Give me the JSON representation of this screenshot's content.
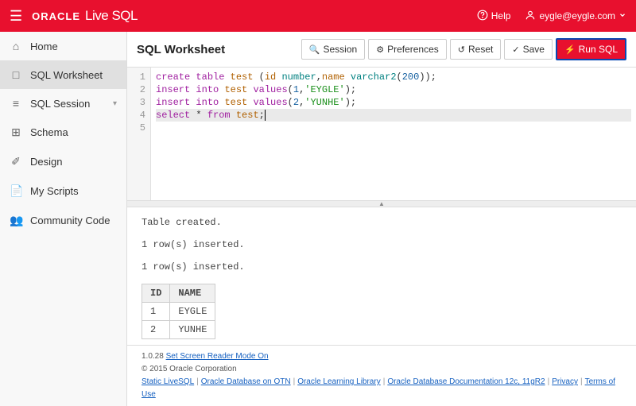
{
  "header": {
    "brand_prefix": "ORACLE",
    "brand_suffix": "Live SQL",
    "help_label": "Help",
    "user_label": "eygle@eygle.com"
  },
  "sidebar": {
    "items": [
      {
        "icon": "home",
        "label": "Home"
      },
      {
        "icon": "worksheet",
        "label": "SQL Worksheet"
      },
      {
        "icon": "session",
        "label": "SQL Session"
      },
      {
        "icon": "schema",
        "label": "Schema"
      },
      {
        "icon": "design",
        "label": "Design"
      },
      {
        "icon": "scripts",
        "label": "My Scripts"
      },
      {
        "icon": "community",
        "label": "Community Code"
      }
    ]
  },
  "toolbar": {
    "title": "SQL Worksheet",
    "session_label": "Session",
    "preferences_label": "Preferences",
    "reset_label": "Reset",
    "save_label": "Save",
    "run_label": "Run SQL"
  },
  "editor": {
    "lines": [
      {
        "n": 1,
        "raw": "create table test (id number,name varchar2(200));"
      },
      {
        "n": 2,
        "raw": "insert into test values(1,'EYGLE');"
      },
      {
        "n": 3,
        "raw": "insert into test values(2,'YUNHE');"
      },
      {
        "n": 4,
        "raw": ""
      },
      {
        "n": 5,
        "raw": "select * from test;"
      }
    ]
  },
  "results": {
    "messages": [
      "Table created.",
      "1 row(s) inserted.",
      "1 row(s) inserted."
    ],
    "table": {
      "columns": [
        "ID",
        "NAME"
      ],
      "rows": [
        [
          "1",
          "EYGLE"
        ],
        [
          "2",
          "YUNHE"
        ]
      ]
    }
  },
  "footer": {
    "version": "1.0.28",
    "screen_reader": "Set Screen Reader Mode On",
    "copyright": "© 2015 Oracle Corporation",
    "links": [
      "Static LiveSQL",
      "Oracle Database on OTN",
      "Oracle Learning Library",
      "Oracle Database Documentation 12c, 11gR2",
      "Privacy",
      "Terms of Use"
    ]
  }
}
